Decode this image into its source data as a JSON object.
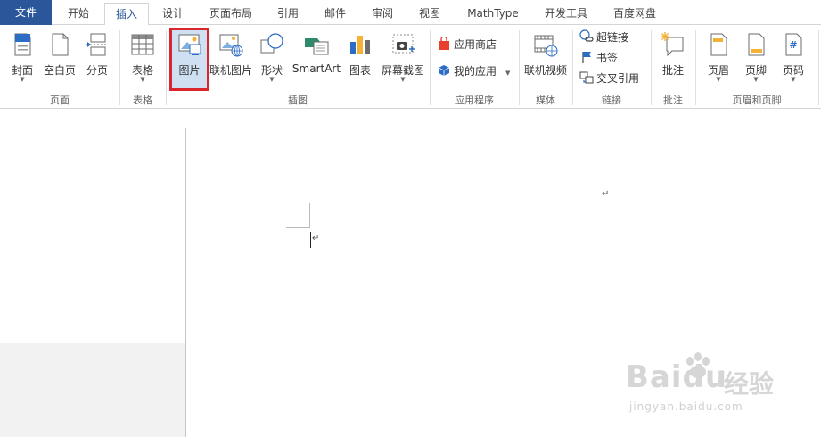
{
  "tabs": [
    {
      "label": "文件"
    },
    {
      "label": "开始"
    },
    {
      "label": "插入"
    },
    {
      "label": "设计"
    },
    {
      "label": "页面布局"
    },
    {
      "label": "引用"
    },
    {
      "label": "邮件"
    },
    {
      "label": "审阅"
    },
    {
      "label": "视图"
    },
    {
      "label": "MathType"
    },
    {
      "label": "开发工具"
    },
    {
      "label": "百度网盘"
    }
  ],
  "ribbon": {
    "pages": {
      "label": "页面",
      "cover": "封面",
      "blank": "空白页",
      "break": "分页"
    },
    "table": {
      "label": "表格",
      "table": "表格"
    },
    "illustrations": {
      "label": "插图",
      "picture": "图片",
      "online_picture": "联机图片",
      "shapes": "形状",
      "smartart": "SmartArt",
      "chart": "图表",
      "screenshot": "屏幕截图"
    },
    "apps": {
      "label": "应用程序",
      "store": "应用商店",
      "my_apps": "我的应用"
    },
    "media": {
      "label": "媒体",
      "online_video": "联机视频"
    },
    "links": {
      "label": "链接",
      "hyperlink": "超链接",
      "bookmark": "书签",
      "cross_ref": "交叉引用"
    },
    "comments": {
      "label": "批注",
      "comment": "批注"
    },
    "header_footer": {
      "label": "页眉和页脚",
      "header": "页眉",
      "footer": "页脚",
      "page_number": "页码"
    }
  },
  "doc": {
    "para_mark": "↵"
  },
  "watermark": {
    "brand": "Baidu",
    "cn": "经验",
    "url": "jingyan.baidu.com"
  },
  "colors": {
    "file_tab": "#2b579a",
    "highlight": "#d9262e"
  }
}
